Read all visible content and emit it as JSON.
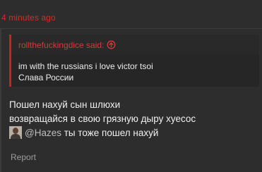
{
  "post": {
    "timestamp": "4 minutes ago",
    "quote": {
      "author_line": "rollthefuckingdice said:",
      "jump_icon": "circle-arrow-up-icon",
      "lines": [
        "im with the russians i love victor tsoi",
        "Слава России"
      ]
    },
    "message": {
      "line1": "Пошел нахуй сын шлюхи",
      "line2": "возвращайся в свою грязную дыру хуесос",
      "mention": "@Hazes",
      "line3_rest": " ты тоже пошел нахуй"
    },
    "report_label": "Report"
  },
  "colors": {
    "background": "#2d2d2d",
    "accent_red": "#d92a2a",
    "quote_bg": "#262626",
    "text": "#f0f0f0",
    "muted": "#9c9c9c"
  }
}
